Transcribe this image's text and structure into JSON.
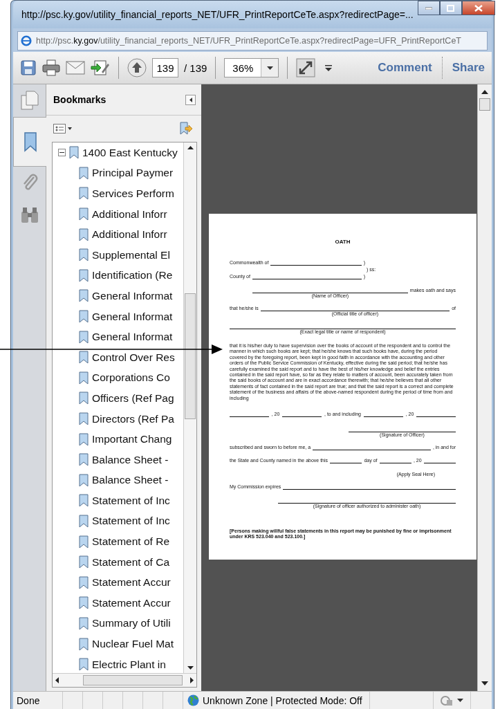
{
  "window": {
    "title": "http://psc.ky.gov/utility_financial_reports_NET/UFR_PrintReportCeTe.aspx?redirectPage=...",
    "address": "http://psc.**ky.gov**/utility_financial_reports_NET/UFR_PrintReportCeTe.aspx?redirectPage=UFR_PrintReportCeT"
  },
  "toolbar": {
    "page_current": "139",
    "page_total": "/ 139",
    "zoom": "36%",
    "comment": "Comment",
    "share": "Share"
  },
  "nav_tabs": [
    {
      "kind": "pages",
      "selected": false
    },
    {
      "kind": "bookmarks",
      "selected": true
    },
    {
      "kind": "attachments",
      "selected": false
    },
    {
      "kind": "search",
      "selected": false
    }
  ],
  "bookmarks": {
    "title": "Bookmarks",
    "tree": [
      {
        "label": "1400 East Kentucky",
        "expanded": true,
        "children": [
          {
            "label": "Principal Paymer"
          },
          {
            "label": "Services Perform"
          },
          {
            "label": "Additional Inforr"
          },
          {
            "label": "Additional Inforr"
          },
          {
            "label": "Supplemental El"
          },
          {
            "label": "Identification (Re"
          },
          {
            "label": "General Informat"
          },
          {
            "label": "General Informat"
          },
          {
            "label": "General Informat"
          },
          {
            "label": "Control Over Res"
          },
          {
            "label": "Corporations Co"
          },
          {
            "label": "Officers (Ref Pag"
          },
          {
            "label": "Directors (Ref Pa"
          },
          {
            "label": "Important Chang"
          },
          {
            "label": "Balance Sheet -"
          },
          {
            "label": "Balance Sheet -"
          },
          {
            "label": "Statement of Inc"
          },
          {
            "label": "Statement of Inc"
          },
          {
            "label": "Statement of Re"
          },
          {
            "label": "Statement of Ca"
          },
          {
            "label": "Statement Accur"
          },
          {
            "label": "Statement Accur"
          },
          {
            "label": "Summary of Utili"
          },
          {
            "label": "Nuclear Fuel Mat"
          },
          {
            "label": "Electric Plant in"
          }
        ]
      }
    ]
  },
  "document": {
    "blocks": [
      {
        "kind": "heading",
        "text": "OATH"
      },
      {
        "kind": "venue",
        "segments": [
          {
            "kind": "text",
            "text": "Commonwealth of"
          },
          {
            "kind": "blank"
          },
          {
            "kind": "text",
            "text": ")"
          }
        ]
      },
      {
        "kind": "venue_mid",
        "segments": [
          {
            "kind": "text",
            "text": ") ss:"
          }
        ]
      },
      {
        "kind": "venue",
        "segments": [
          {
            "kind": "text",
            "text": "County of"
          },
          {
            "kind": "blank"
          },
          {
            "kind": "text",
            "text": ")"
          }
        ]
      },
      {
        "kind": "indented",
        "segments": [
          {
            "kind": "blank",
            "caption": "(Name of Officer)"
          },
          {
            "kind": "text",
            "text": "makes oath and says"
          }
        ]
      },
      {
        "kind": "row",
        "segments": [
          {
            "kind": "text",
            "text": "that he/she is"
          },
          {
            "kind": "blank",
            "caption": "(Official title of officer)"
          },
          {
            "kind": "text",
            "text": "of"
          }
        ]
      },
      {
        "kind": "row",
        "segments": [
          {
            "kind": "blank",
            "caption": "(Exact legal title or name of respondent)"
          }
        ]
      },
      {
        "kind": "paragraph",
        "text": "that it is his/her duty to have supervision over the books of account of the respondent and to control the manner in which such books are kept; that he/she knows that such books have, during the period covered by the foregoing report, been kept in good faith in accordance with the accounting and other orders of the Public Service Commission of Kentucky, effective during the said period; that he/she has carefully examined the said report and to have the best of his/her knowledge and belief the entries contained in the said report have, so far as they relate to matters of account, been accurately taken from the said books of account and are in exact accordance therewith; that he/she believes that all other statements of fact contained in the said report are true; and that the said report is a correct and complete statement of the business and affairs of the above-named respondent during the period of time from and including"
      },
      {
        "kind": "dates",
        "segments": [
          {
            "kind": "blank"
          },
          {
            "kind": "text",
            "text": ", 20"
          },
          {
            "kind": "blank"
          },
          {
            "kind": "text",
            "text": ", to and including"
          },
          {
            "kind": "blank"
          },
          {
            "kind": "text",
            "text": ", 20"
          },
          {
            "kind": "blank"
          }
        ]
      },
      {
        "kind": "signature",
        "segments": [
          {
            "kind": "blank",
            "caption": "(Signature of Officer)"
          }
        ]
      },
      {
        "kind": "row",
        "segments": [
          {
            "kind": "text",
            "text": "subscribed and sworn to before me, a"
          },
          {
            "kind": "blank"
          },
          {
            "kind": "text",
            "text": ", in and for"
          }
        ]
      },
      {
        "kind": "row",
        "segments": [
          {
            "kind": "text",
            "text": "the State and County named in the above this"
          },
          {
            "kind": "blank"
          },
          {
            "kind": "text",
            "text": "day of"
          },
          {
            "kind": "blank"
          },
          {
            "kind": "text",
            "text": ", 20"
          },
          {
            "kind": "blank"
          }
        ]
      },
      {
        "kind": "seal",
        "text": "(Apply Seal Here)"
      },
      {
        "kind": "row",
        "segments": [
          {
            "kind": "text",
            "text": "My Commission expires"
          },
          {
            "kind": "blank"
          }
        ]
      },
      {
        "kind": "signature_wide",
        "segments": [
          {
            "kind": "blank",
            "caption": "(Signature of officer authorized to administer oath)"
          }
        ]
      },
      {
        "kind": "warning",
        "text": "[Persons making willful false statements in this report may be punished by fine or imprisonment under KRS 523.040 and 523.100.]"
      }
    ]
  },
  "status_bar": {
    "status": "Done",
    "zone": "Unknown Zone | Protected Mode: Off"
  }
}
